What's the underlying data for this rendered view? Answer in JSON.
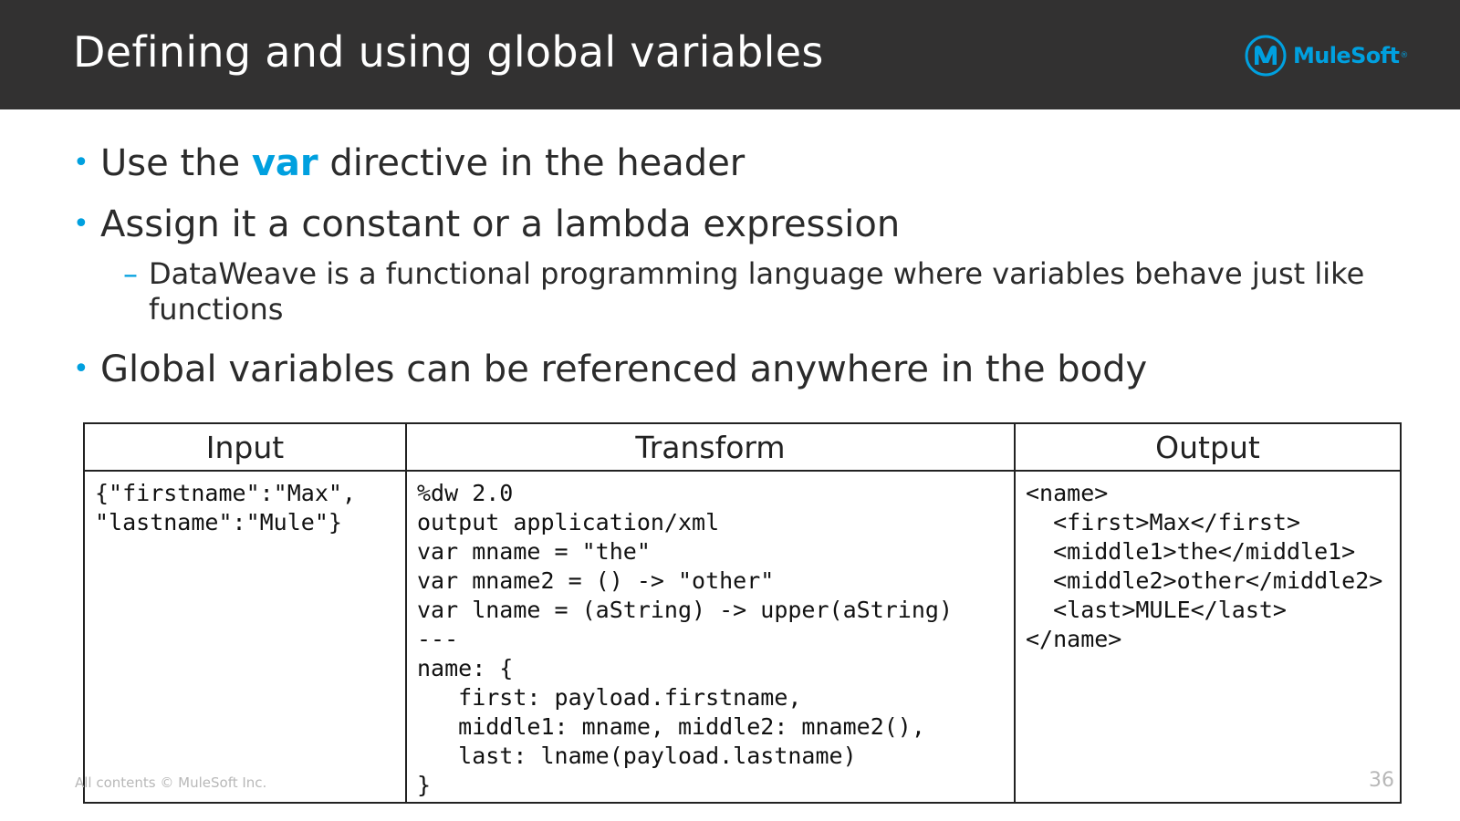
{
  "slide": {
    "title": "Defining and using global variables",
    "logo_text": "MuleSoft",
    "logo_reg": "®"
  },
  "bullets": [
    {
      "before": "Use the ",
      "keyword": "var",
      "after": " directive in the header"
    },
    {
      "text": "Assign it a constant or a lambda expression"
    },
    {
      "text": "Global variables can be referenced anywhere in the body"
    }
  ],
  "sub_bullets": [
    {
      "text": "DataWeave is a functional programming language where variables behave just like functions"
    }
  ],
  "bullet_marker": "•",
  "sub_marker": "–",
  "table": {
    "headers": [
      "Input",
      "Transform",
      "Output"
    ],
    "input": "{\"firstname\":\"Max\",\n\"lastname\":\"Mule\"}",
    "transform": "%dw 2.0\noutput application/xml\nvar mname = \"the\"\nvar mname2 = () -> \"other\"\nvar lname = (aString) -> upper(aString)\n---\nname: {\n   first: payload.firstname,\n   middle1: mname, middle2: mname2(),\n   last: lname(payload.lastname)\n}",
    "output": "<name>\n  <first>Max</first>\n  <middle1>the</middle1>\n  <middle2>other</middle2>\n  <last>MULE</last>\n</name>"
  },
  "footer": {
    "copyright": "All contents © MuleSoft Inc.",
    "page_number": "36"
  },
  "colors": {
    "header_bg": "#323131",
    "accent": "#00a0df",
    "title_text": "#ffffff",
    "footer_text": "#b8b8b8"
  },
  "icons": {
    "logo": "mulesoft-logo-icon"
  }
}
